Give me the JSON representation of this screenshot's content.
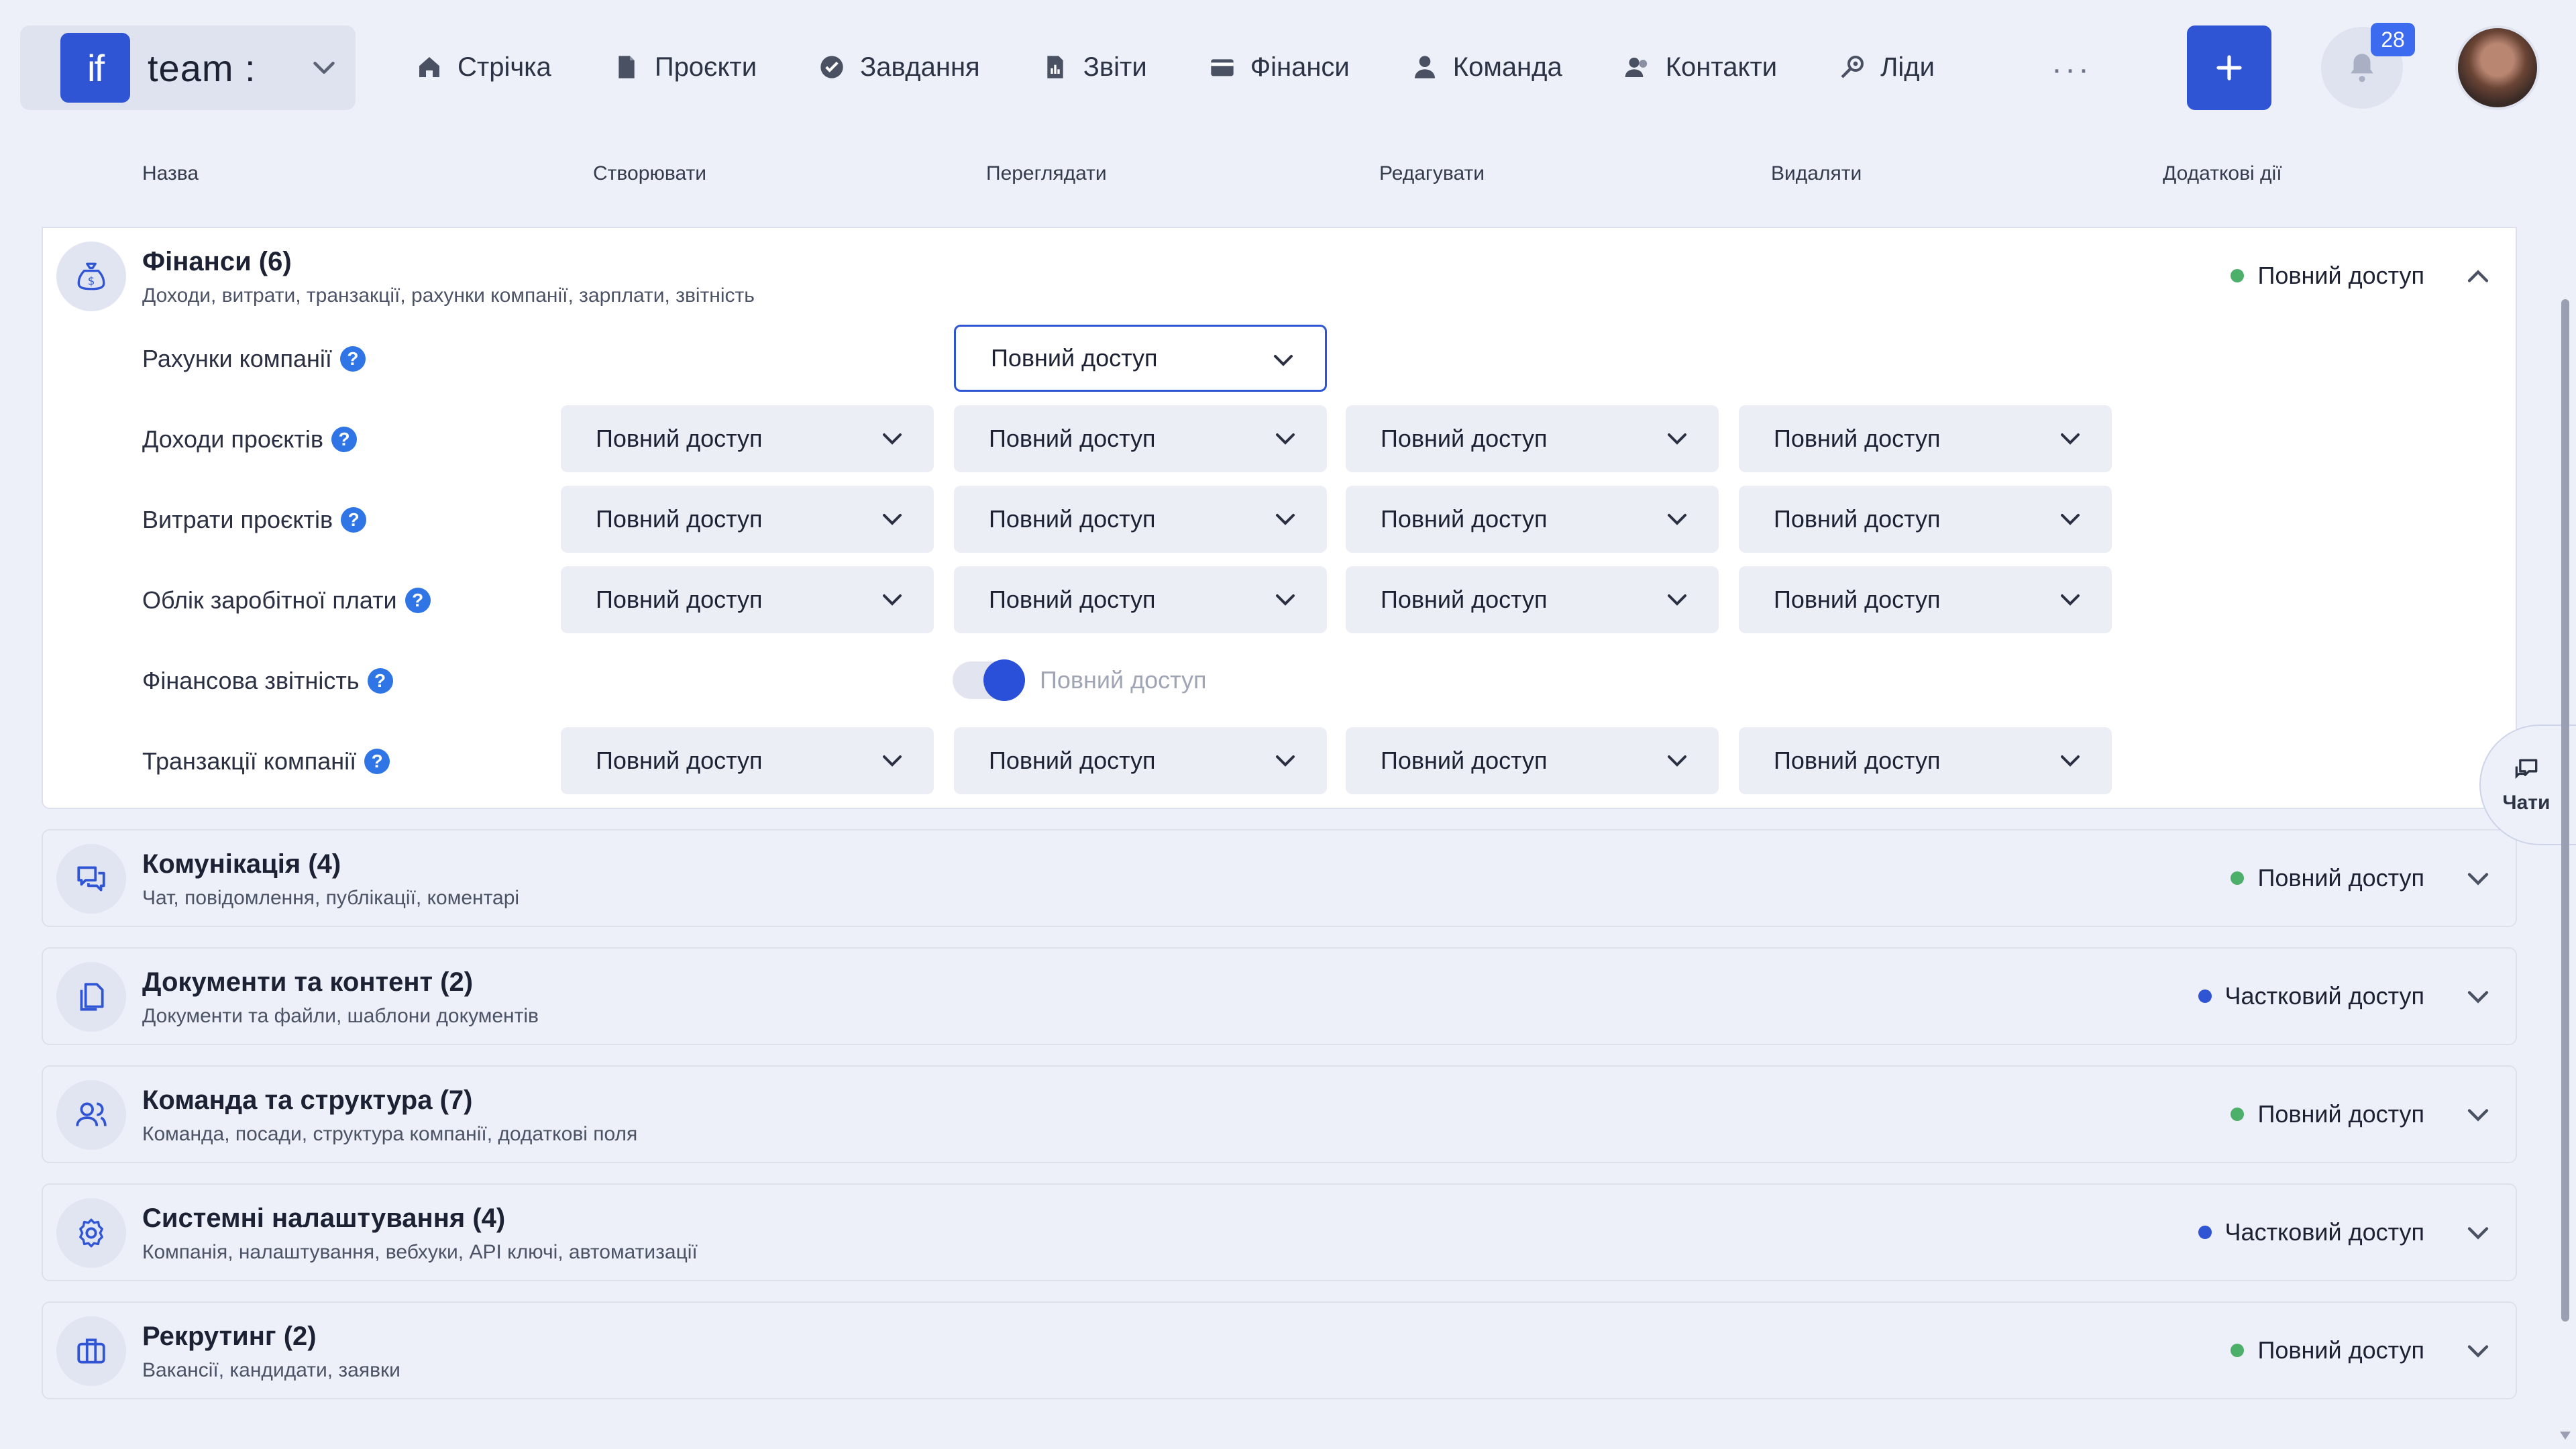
{
  "app": {
    "logo_text": "if",
    "team_name": "team :",
    "notifications_count": "28",
    "more_label": "···"
  },
  "nav": [
    {
      "label": "Стрічка",
      "icon": "home-icon"
    },
    {
      "label": "Проєкти",
      "icon": "file-icon"
    },
    {
      "label": "Завдання",
      "icon": "check-circle-icon"
    },
    {
      "label": "Звіти",
      "icon": "report-icon"
    },
    {
      "label": "Фінанси",
      "icon": "wallet-icon"
    },
    {
      "label": "Команда",
      "icon": "user-icon"
    },
    {
      "label": "Контакти",
      "icon": "contacts-icon"
    },
    {
      "label": "Ліди",
      "icon": "leads-icon"
    }
  ],
  "columns": [
    "Назва",
    "Створювати",
    "Переглядати",
    "Редагувати",
    "Видаляти",
    "Додаткові дії"
  ],
  "finance": {
    "title": "Фінанси (6)",
    "subtitle": "Доходи, витрати, транзакції, рахунки компанії, зарплати, звітність",
    "status": "Повний доступ",
    "rows": [
      {
        "label": "Рахунки компанії",
        "view": "Повний доступ"
      },
      {
        "label": "Доходи проєктів",
        "create": "Повний доступ",
        "view": "Повний доступ",
        "edit": "Повний доступ",
        "delete": "Повний доступ"
      },
      {
        "label": "Витрати проєктів",
        "create": "Повний доступ",
        "view": "Повний доступ",
        "edit": "Повний доступ",
        "delete": "Повний доступ"
      },
      {
        "label": "Облік заробітної плати",
        "create": "Повний доступ",
        "view": "Повний доступ",
        "edit": "Повний доступ",
        "delete": "Повний доступ"
      },
      {
        "label": "Фінансова звітність",
        "toggle_label": "Повний доступ",
        "toggle_on": true
      },
      {
        "label": "Транзакції компанії",
        "create": "Повний доступ",
        "view": "Повний доступ",
        "edit": "Повний доступ",
        "delete": "Повний доступ"
      }
    ]
  },
  "sections": [
    {
      "title": "Комунікація (4)",
      "subtitle": "Чат, повідомлення, публікації, коментарі",
      "status": "Повний доступ",
      "status_color": "#4caf6a",
      "icon": "chat-icon"
    },
    {
      "title": "Документи та контент (2)",
      "subtitle": "Документи та файли, шаблони документів",
      "status": "Частковий доступ",
      "status_color": "#2f55d4",
      "icon": "documents-icon"
    },
    {
      "title": "Команда та структура (7)",
      "subtitle": "Команда, посади, структура компанії, додаткові поля",
      "status": "Повний доступ",
      "status_color": "#4caf6a",
      "icon": "team-icon"
    },
    {
      "title": "Системні налаштування (4)",
      "subtitle": "Компанія, налаштування, вебхуки, API ключі, автоматизації",
      "status": "Частковий доступ",
      "status_color": "#2f55d4",
      "icon": "gear-icon"
    },
    {
      "title": "Рекрутинг (2)",
      "subtitle": "Вакансії, кандидати, заявки",
      "status": "Повний доступ",
      "status_color": "#4caf6a",
      "icon": "briefcase-icon"
    }
  ],
  "chat_fab": {
    "label": "Чати"
  },
  "colors": {
    "accent": "#2f55d4",
    "status_full": "#4caf6a",
    "status_partial": "#2f55d4"
  }
}
